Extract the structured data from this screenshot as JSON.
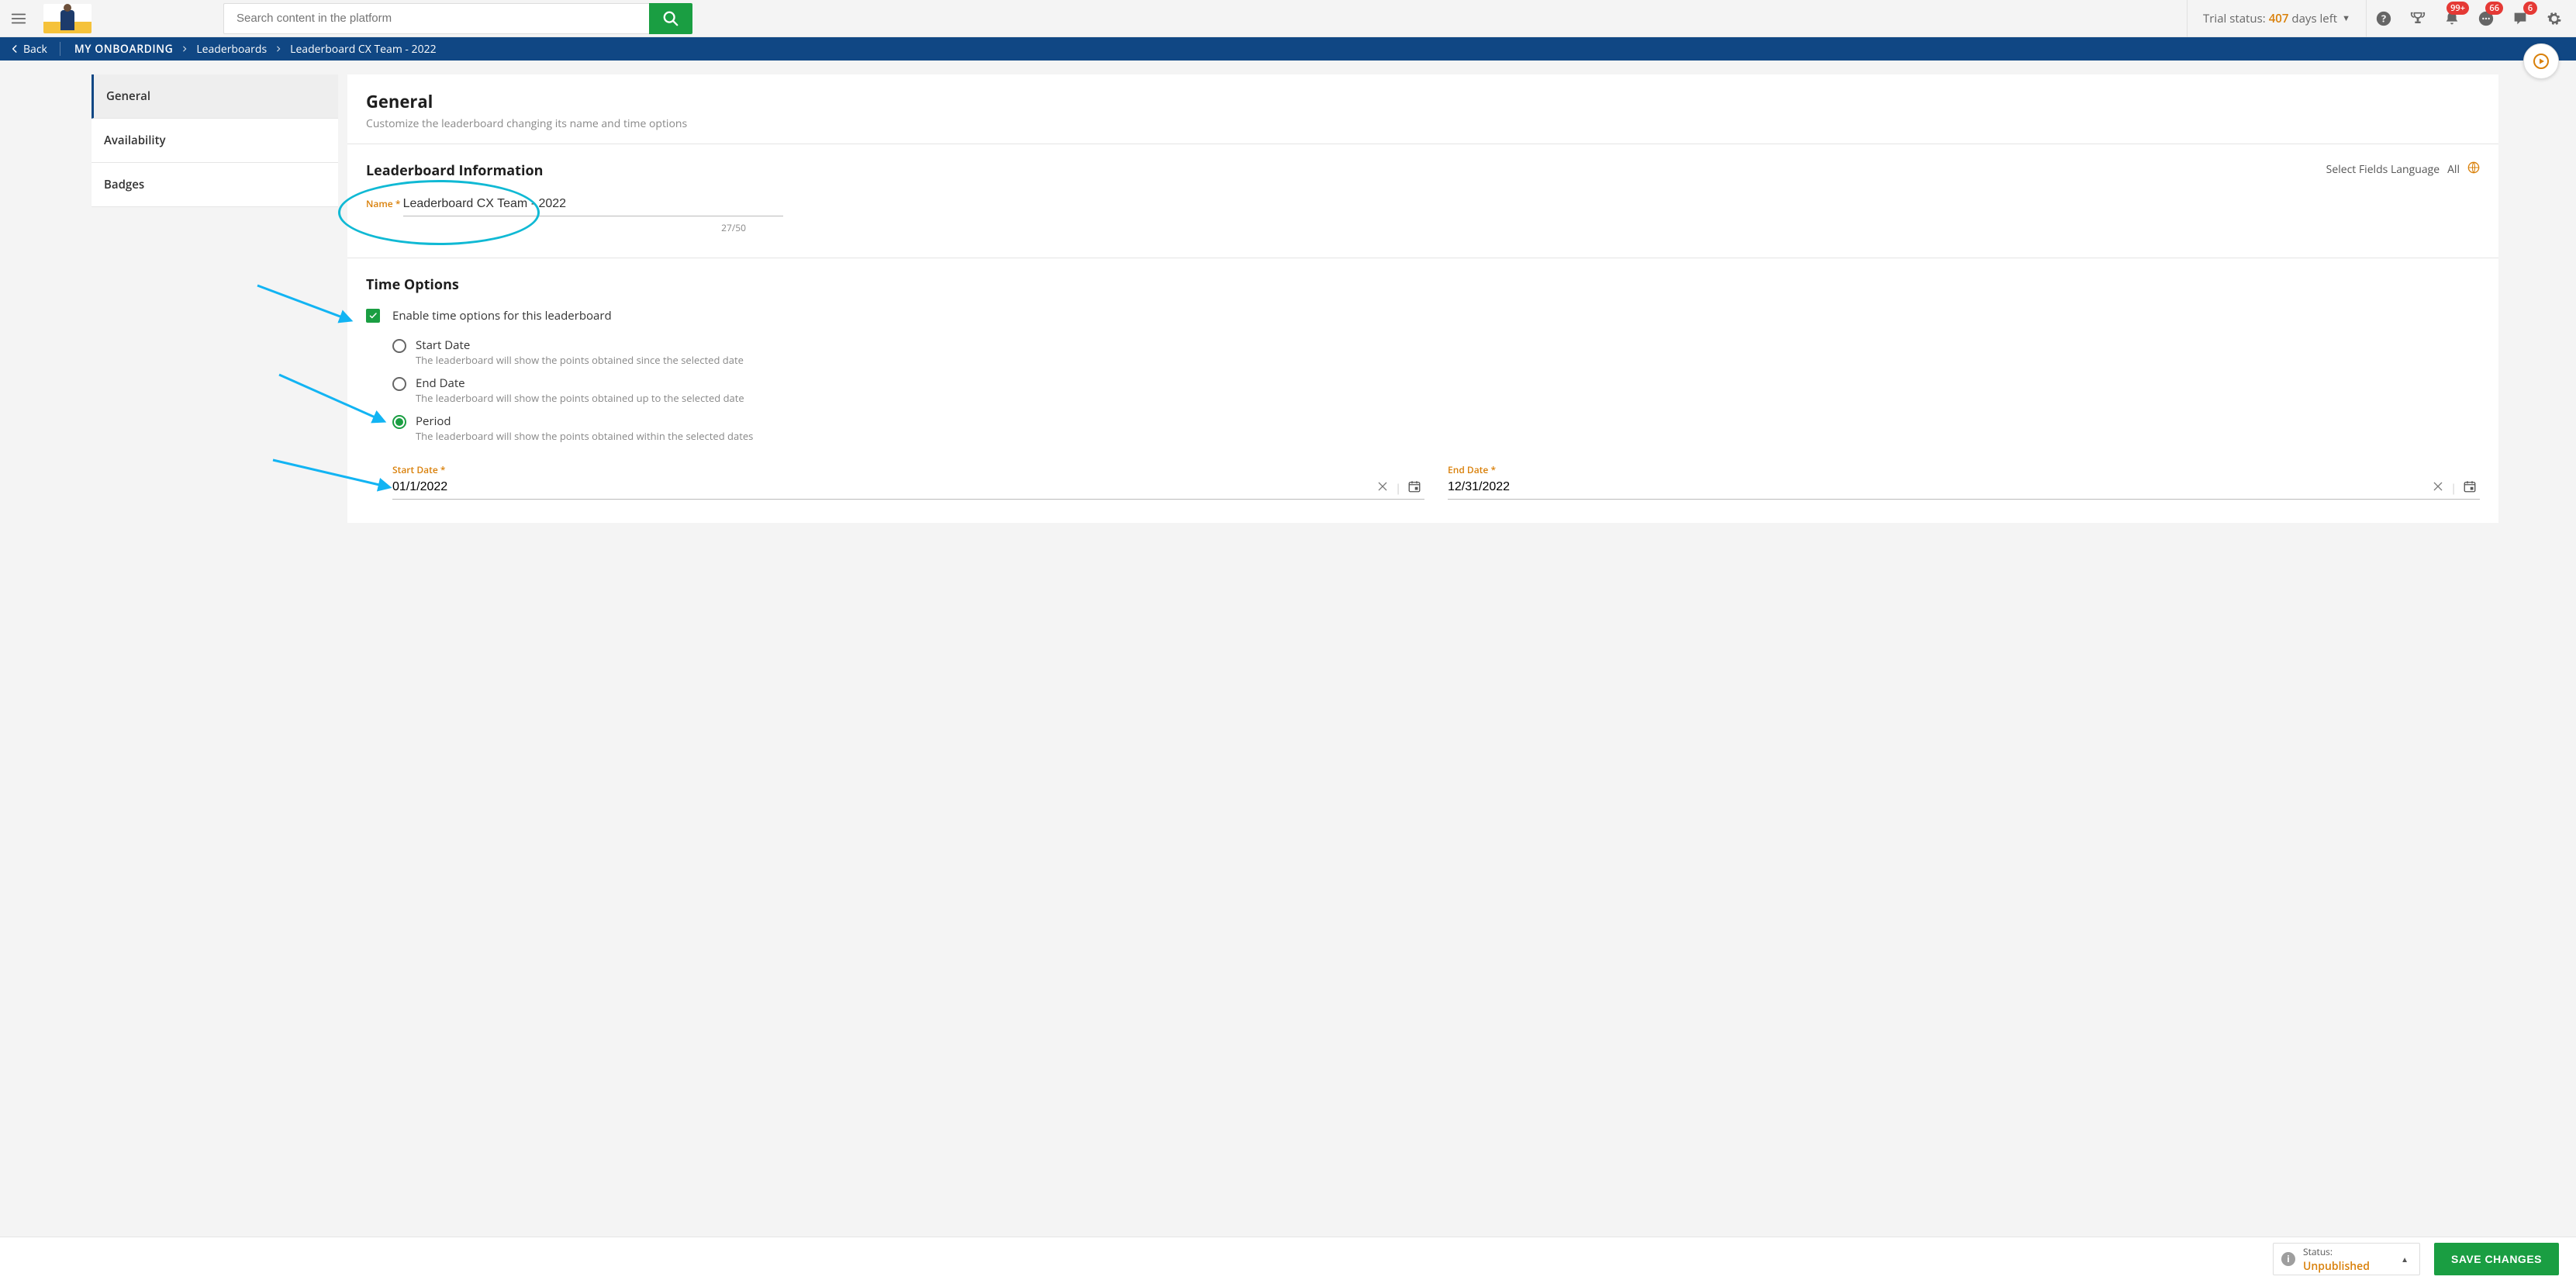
{
  "topbar": {
    "search_placeholder": "Search content in the platform",
    "trial_label_prefix": "Trial status:",
    "trial_days": "407",
    "trial_label_suffix": "days left",
    "badges": {
      "notifications": "99+",
      "chat": "66",
      "comments": "6"
    }
  },
  "breadcrumb": {
    "back_label": "Back",
    "root": "MY ONBOARDING",
    "level1": "Leaderboards",
    "current": "Leaderboard CX Team - 2022"
  },
  "side_nav": {
    "items": [
      {
        "label": "General",
        "active": true
      },
      {
        "label": "Availability",
        "active": false
      },
      {
        "label": "Badges",
        "active": false
      }
    ]
  },
  "panel_header": {
    "title": "General",
    "subtitle": "Customize the leaderboard changing its name and time options"
  },
  "info_section": {
    "title": "Leaderboard Information",
    "lang_label": "Select Fields Language",
    "lang_value": "All",
    "name_label": "Name",
    "name_value": "Leaderboard CX Team - 2022",
    "name_counter": "27/50"
  },
  "time_section": {
    "title": "Time Options",
    "enable_label": "Enable time options for this leaderboard",
    "options": {
      "start": {
        "label": "Start Date",
        "hint": "The leaderboard will show the points obtained since the selected date"
      },
      "end": {
        "label": "End Date",
        "hint": "The leaderboard will show the points obtained up to the selected date"
      },
      "period": {
        "label": "Period",
        "hint": "The leaderboard will show the points obtained within the selected dates"
      }
    },
    "start_date_label": "Start Date",
    "start_date_value": "01/1/2022",
    "end_date_label": "End Date",
    "end_date_value": "12/31/2022"
  },
  "footer": {
    "status_label": "Status:",
    "status_value": "Unpublished",
    "save_label": "SAVE CHANGES"
  }
}
